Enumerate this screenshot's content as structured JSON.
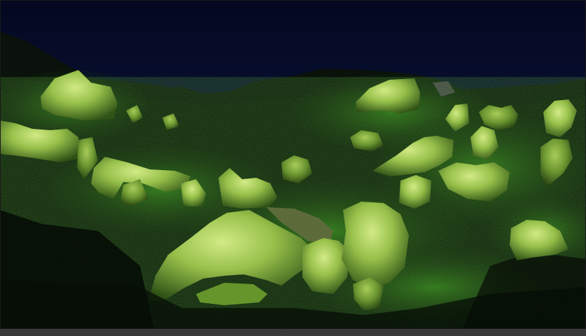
{
  "scene": {
    "description_colors": {
      "sky_top": "#050a24",
      "sky_bottom": "#0d1c4a",
      "ridge": "#0a0f0a",
      "hillside": "#081008",
      "foliage": "#1f5a12",
      "rock_lit": "#b8d86a",
      "rock_mid": "#7ea83c",
      "rock_shadow": "#2c4a16"
    }
  }
}
